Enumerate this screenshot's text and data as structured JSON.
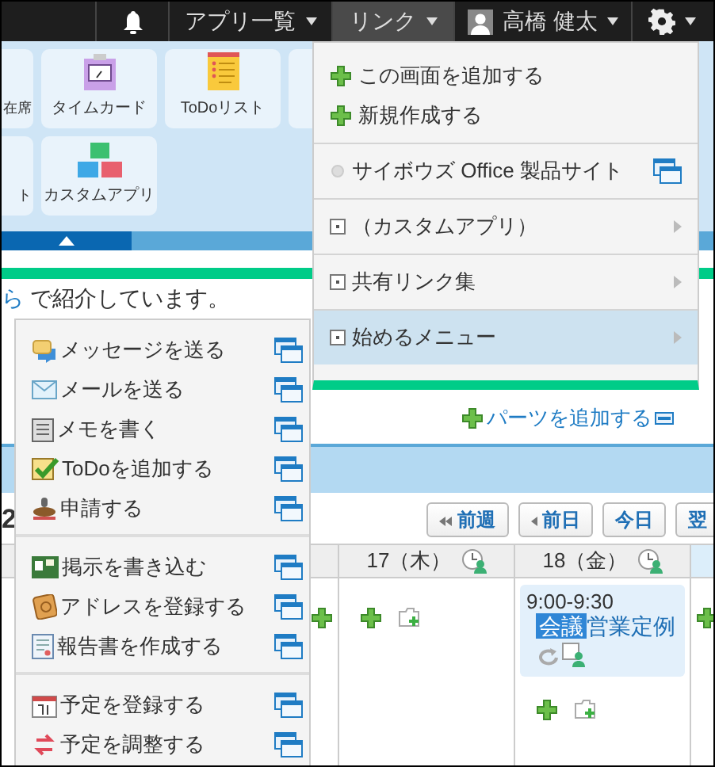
{
  "top_bar": {
    "items": [
      {
        "kind": "bell"
      },
      {
        "kind": "menu",
        "label": "アプリ一覧",
        "selected": false
      },
      {
        "kind": "menu",
        "label": "リンク",
        "selected": true
      },
      {
        "kind": "user",
        "label": "高橋 健太"
      },
      {
        "kind": "gear"
      }
    ]
  },
  "apps": [
    {
      "kind": "partial",
      "label": "在席"
    },
    {
      "kind": "timecard",
      "label": "タイムカード"
    },
    {
      "kind": "todo",
      "label": "ToDoリスト"
    },
    {
      "kind": "blank"
    },
    {
      "kind": "partial",
      "label": "ト"
    },
    {
      "kind": "custom",
      "label": "カスタムアプリ"
    }
  ],
  "intro": {
    "link": "ら",
    "text": "で紹介しています。"
  },
  "link_menu": {
    "groups": [
      [
        {
          "kind": "add",
          "label": "この画面を追加する",
          "selected": false
        },
        {
          "kind": "add",
          "label": "新規作成する",
          "selected": false
        }
      ],
      [
        {
          "kind": "site",
          "label": "サイボウズ Office 製品サイト",
          "selected": false
        }
      ],
      [
        {
          "kind": "folder",
          "label": "（カスタムアプリ）",
          "selected": false
        }
      ],
      [
        {
          "kind": "folder",
          "label": "共有リンク集",
          "selected": false
        }
      ],
      [
        {
          "kind": "folder",
          "label": "始めるメニュー",
          "selected": true
        }
      ]
    ]
  },
  "add_parts": "パーツを追加する",
  "row_label": "2",
  "nav_buttons": [
    {
      "kind": "double",
      "label": "前週"
    },
    {
      "kind": "single",
      "label": "前日"
    },
    {
      "kind": "plain",
      "label": "今日"
    },
    {
      "kind": "plain",
      "label": "翌"
    }
  ],
  "calendar": {
    "days": [
      {
        "label": "17（木）"
      },
      {
        "label": "18（金）",
        "events": [
          {
            "time": "9:00-9:30",
            "tag": "会議",
            "title": "営業定例"
          }
        ]
      }
    ]
  },
  "start_menu": {
    "groups": [
      [
        {
          "kind": "message",
          "label": "メッセージを送る"
        },
        {
          "kind": "mail",
          "label": "メールを送る"
        },
        {
          "kind": "memo",
          "label": "メモを書く"
        },
        {
          "kind": "todo",
          "label": "ToDoを追加する"
        },
        {
          "kind": "stamp",
          "label": "申請する"
        }
      ],
      [
        {
          "kind": "board",
          "label": "掲示を書き込む"
        },
        {
          "kind": "address",
          "label": "アドレスを登録する"
        },
        {
          "kind": "report",
          "label": "報告書を作成する"
        }
      ],
      [
        {
          "kind": "calendar",
          "label": "予定を登録する"
        },
        {
          "kind": "adjust",
          "label": "予定を調整する"
        }
      ]
    ]
  }
}
